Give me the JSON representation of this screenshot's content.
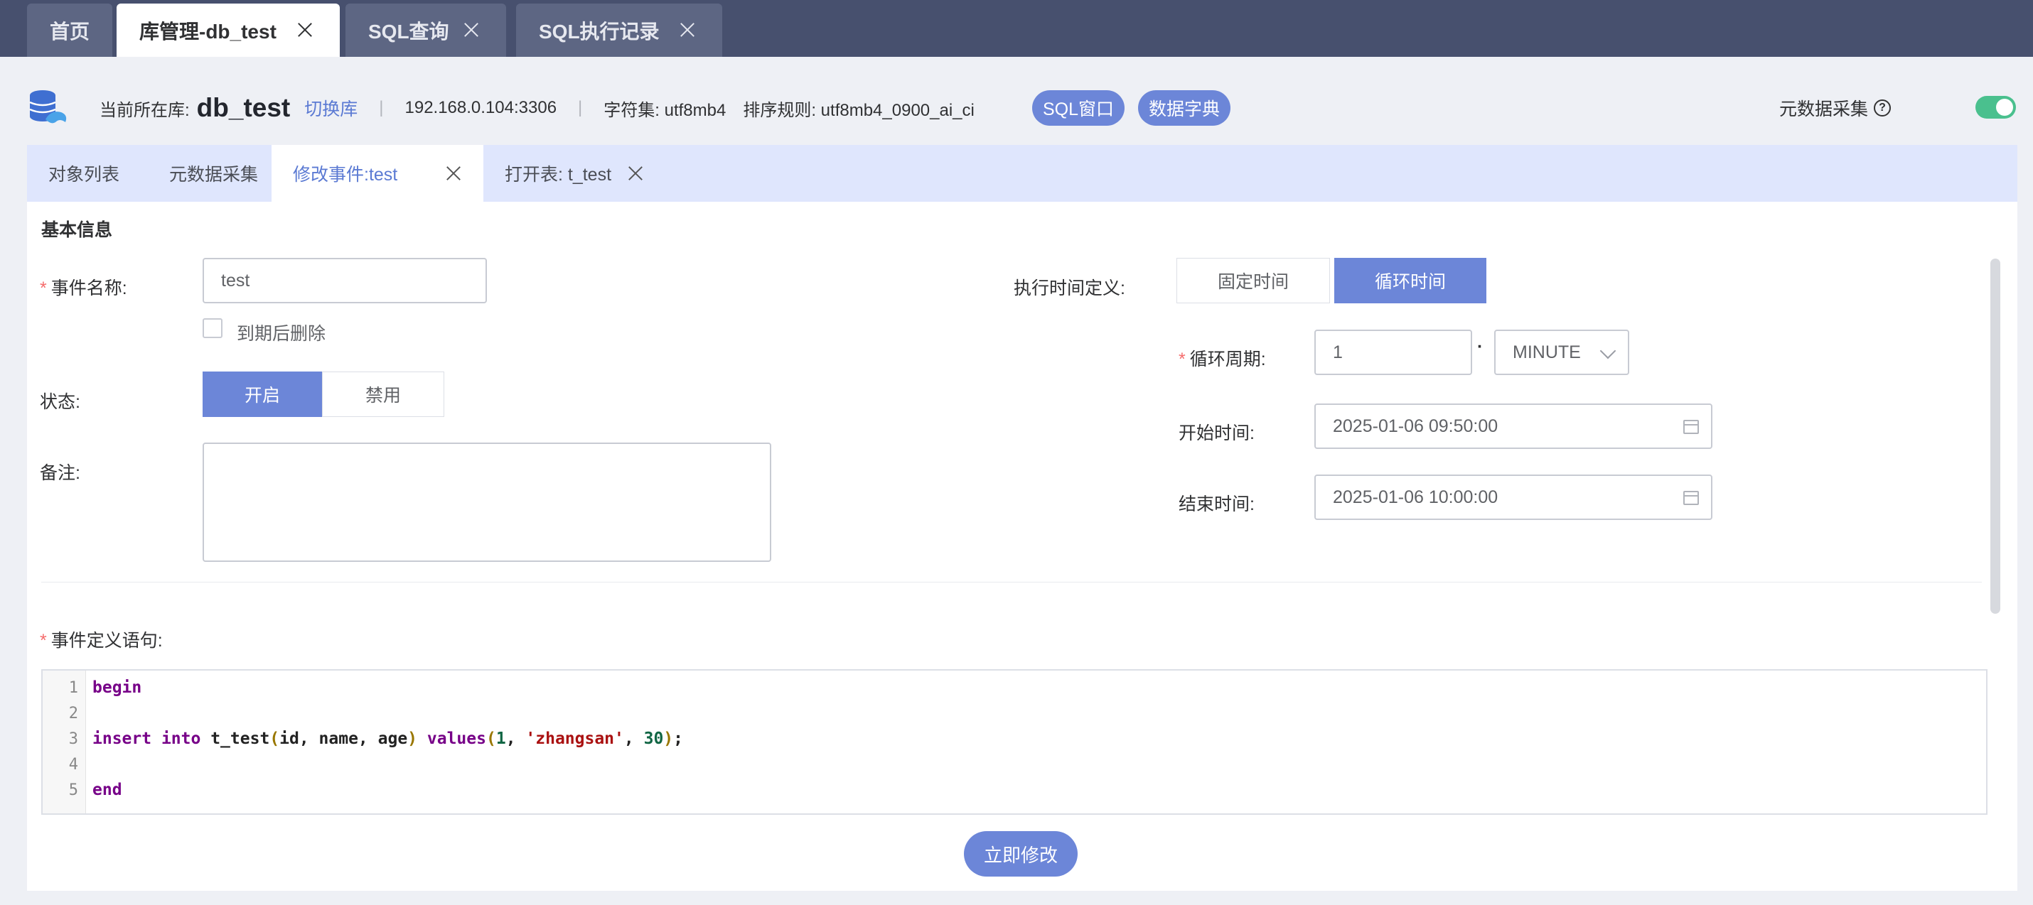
{
  "top_tabs": [
    {
      "label": "首页",
      "active": false,
      "closable": false
    },
    {
      "label": "库管理-db_test",
      "active": true,
      "closable": true
    },
    {
      "label": "SQL查询",
      "active": false,
      "closable": true
    },
    {
      "label": "SQL执行记录",
      "active": false,
      "closable": true
    }
  ],
  "db_info": {
    "current_label": "当前所在库:",
    "db_name": "db_test",
    "switch_label": "切换库",
    "host": "192.168.0.104:3306",
    "charset": "字符集: utf8mb4",
    "collation": "排序规则: utf8mb4_0900_ai_ci",
    "sql_window_label": "SQL窗口",
    "data_dict_label": "数据字典",
    "metadata_collect_label": "元数据采集",
    "metadata_collect_on": true,
    "help_glyph": "?"
  },
  "sub_tabs": [
    {
      "label": "对象列表",
      "active": false
    },
    {
      "label": "元数据采集",
      "active": false
    },
    {
      "label": "修改事件:test",
      "active": true
    },
    {
      "label": "打开表: t_test",
      "active": false
    }
  ],
  "form": {
    "section_title": "基本信息",
    "event_name_label": "事件名称:",
    "event_name_value": "test",
    "delete_on_expire_label": "到期后删除",
    "status_label": "状态:",
    "status_on_label": "开启",
    "status_off_label": "禁用",
    "remark_label": "备注:",
    "exec_time_label": "执行时间定义:",
    "fixed_time_label": "固定时间",
    "loop_time_label": "循环时间",
    "cycle_label": "循环周期:",
    "cycle_value": "1",
    "cycle_unit": "MINUTE",
    "cycle_dot": "·",
    "start_label": "开始时间:",
    "start_value": "2025-01-06 09:50:00",
    "end_label": "结束时间:",
    "end_value": "2025-01-06 10:00:00",
    "definition_label": "事件定义语句:"
  },
  "code": {
    "line_numbers": [
      "1",
      "2",
      "3",
      "4",
      "5"
    ],
    "kw_begin": "begin",
    "kw_insert": "insert",
    "kw_into": "into",
    "table": "t_test",
    "lparen": "(",
    "cols": "id, name, age",
    "rparen": ")",
    "kw_values": "values",
    "val_1": "1",
    "comma": ", ",
    "val_str": "'zhangsan'",
    "val_30": "30",
    "semi": ";",
    "kw_end": "end"
  },
  "submit_label": "立即修改",
  "colors": {
    "accent": "#6c86d8",
    "topbar": "#47506e",
    "toggle_on": "#4ac08e",
    "required": "#f56c6c"
  }
}
